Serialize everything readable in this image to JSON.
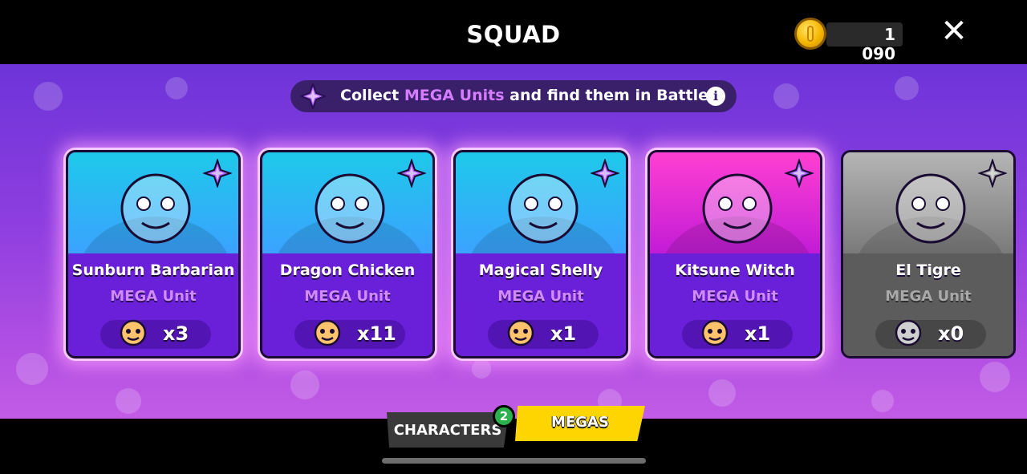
{
  "header": {
    "title": "SQUAD",
    "coins": "1 090",
    "close_icon": "close-icon"
  },
  "banner": {
    "text_before": "Collect ",
    "text_highlight": "MEGA Units",
    "text_after": " and find them in Battles!",
    "info_icon": "i"
  },
  "cards": [
    {
      "name": "Sunburn Barbarian",
      "subtitle": "MEGA Unit",
      "count": "x3",
      "color_top": "#1ec9ea",
      "color_bottom": "#3ba2ff",
      "owned": true
    },
    {
      "name": "Dragon Chicken",
      "subtitle": "MEGA Unit",
      "count": "x11",
      "color_top": "#1ec9ea",
      "color_bottom": "#3ba2ff",
      "owned": true
    },
    {
      "name": "Magical Shelly",
      "subtitle": "MEGA Unit",
      "count": "x1",
      "color_top": "#1ec9ea",
      "color_bottom": "#3ba2ff",
      "owned": true
    },
    {
      "name": "Kitsune Witch",
      "subtitle": "MEGA Unit",
      "count": "x1",
      "color_top": "#ff3fd2",
      "color_bottom": "#c21cd6",
      "owned": true
    },
    {
      "name": "El Tigre",
      "subtitle": "MEGA Unit",
      "count": "x0",
      "color_top": "#b5b5b5",
      "color_bottom": "#7a7a7a",
      "owned": false
    }
  ],
  "tabs": {
    "characters": "CHARACTERS",
    "characters_badge": "2",
    "megas": "MEGAS",
    "active": "MEGAS"
  },
  "colors": {
    "accent_purple": "#6a1fd8",
    "highlight": "#d67cff",
    "tab_active": "#ffd500",
    "badge_green": "#2bb24c"
  }
}
